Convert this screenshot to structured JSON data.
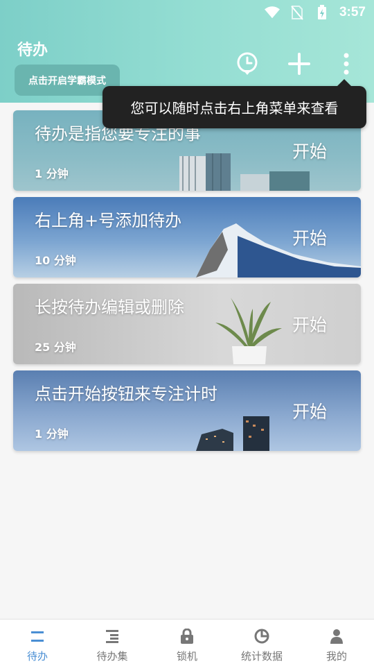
{
  "status_bar": {
    "time": "3:57",
    "icons": [
      "wifi-icon",
      "no-sim-icon",
      "battery-charging-icon"
    ]
  },
  "header": {
    "title": "待办",
    "mode_button": "点击开启学霸模式",
    "actions": [
      "clock-icon",
      "plus-icon",
      "more-icon"
    ]
  },
  "tooltip": {
    "text": "您可以随时点击右上角菜单来查看"
  },
  "todos": [
    {
      "title": "待办是指您要专注的事",
      "duration": "1 分钟",
      "start": "开始"
    },
    {
      "title": "右上角+号添加待办",
      "duration": "10 分钟",
      "start": "开始"
    },
    {
      "title": "长按待办编辑或删除",
      "duration": "25 分钟",
      "start": "开始"
    },
    {
      "title": "点击开始按钮来专注计时",
      "duration": "1 分钟",
      "start": "开始"
    }
  ],
  "bottom_nav": {
    "items": [
      {
        "label": "待办",
        "icon": "todo-icon",
        "active": true
      },
      {
        "label": "待办集",
        "icon": "todo-set-icon",
        "active": false
      },
      {
        "label": "锁机",
        "icon": "lock-icon",
        "active": false
      },
      {
        "label": "统计数据",
        "icon": "pie-chart-icon",
        "active": false
      },
      {
        "label": "我的",
        "icon": "person-icon",
        "active": false
      }
    ]
  },
  "colors": {
    "header": "#93ddd2",
    "active_nav": "#4a8fd4",
    "tooltip": "#222222"
  }
}
